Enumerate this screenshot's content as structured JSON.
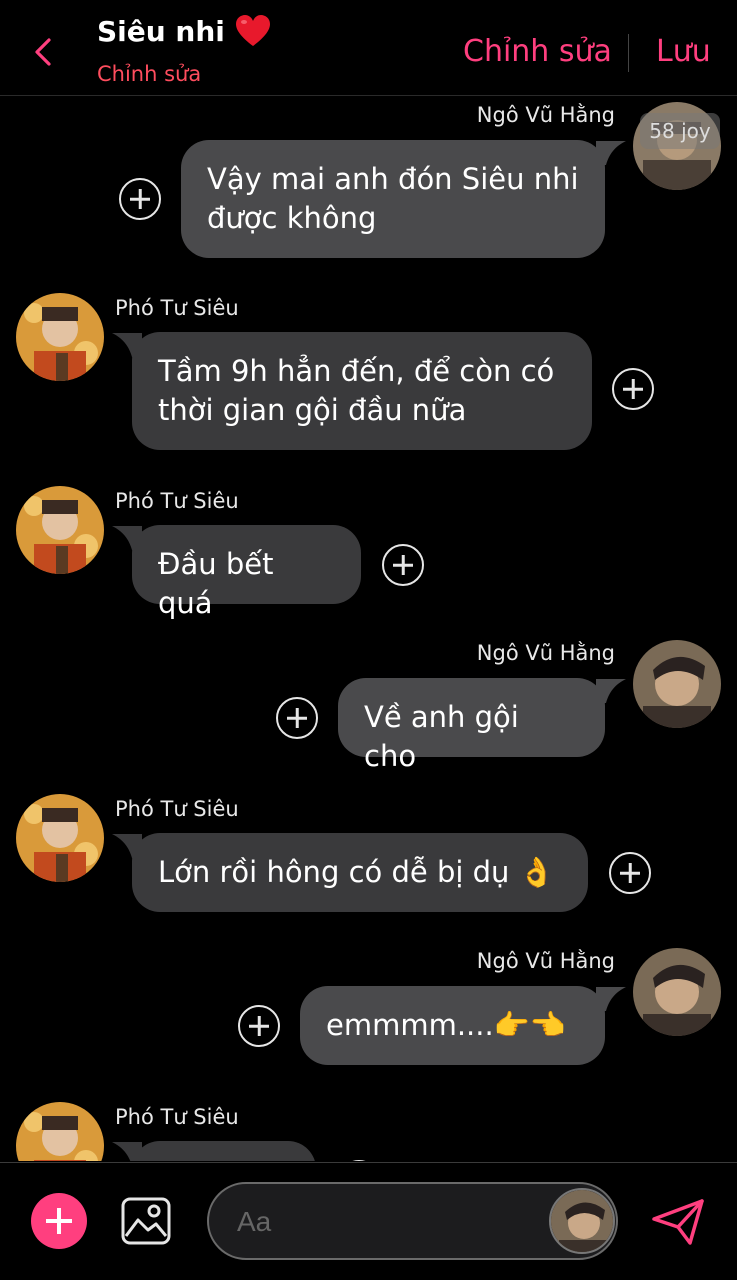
{
  "header": {
    "title": "Siêu nhi",
    "subtitle": "Chỉnh sửa",
    "edit_label": "Chỉnh sửa",
    "save_label": "Lưu"
  },
  "watermark": "58 joy",
  "messages": [
    {
      "sender": "Ngô Vũ Hằng",
      "side": "right",
      "lines": [
        "Vậy mai anh đón Siêu nhi",
        "được không"
      ]
    },
    {
      "sender": "Phó Tư Siêu",
      "side": "left",
      "lines": [
        "Tầm 9h hẳn đến, để còn có",
        "thời gian gội đầu nữa"
      ]
    },
    {
      "sender": "Phó Tư Siêu",
      "side": "left",
      "lines": [
        "Đầu bết quá"
      ]
    },
    {
      "sender": "Ngô Vũ Hằng",
      "side": "right",
      "lines": [
        "Về anh gội cho"
      ]
    },
    {
      "sender": "Phó Tư Siêu",
      "side": "left",
      "lines": [
        "Lớn rồi hông có dễ bị dụ 👌"
      ]
    },
    {
      "sender": "Ngô Vũ Hằng",
      "side": "right",
      "lines": [
        "emmmm....👉👈"
      ]
    },
    {
      "sender": "Phó Tư Siêu",
      "side": "left",
      "lines": [
        ""
      ]
    }
  ],
  "input": {
    "placeholder": "Aa"
  },
  "colors": {
    "accent": "#ff3f7f",
    "subtitle": "#ff4d5e",
    "bubble": "#3a3a3c",
    "background": "#000000"
  },
  "icons": {
    "back": "chevron-left-icon",
    "add": "plus-icon",
    "image": "image-icon",
    "send": "send-icon",
    "react": "plus-circle-icon"
  }
}
